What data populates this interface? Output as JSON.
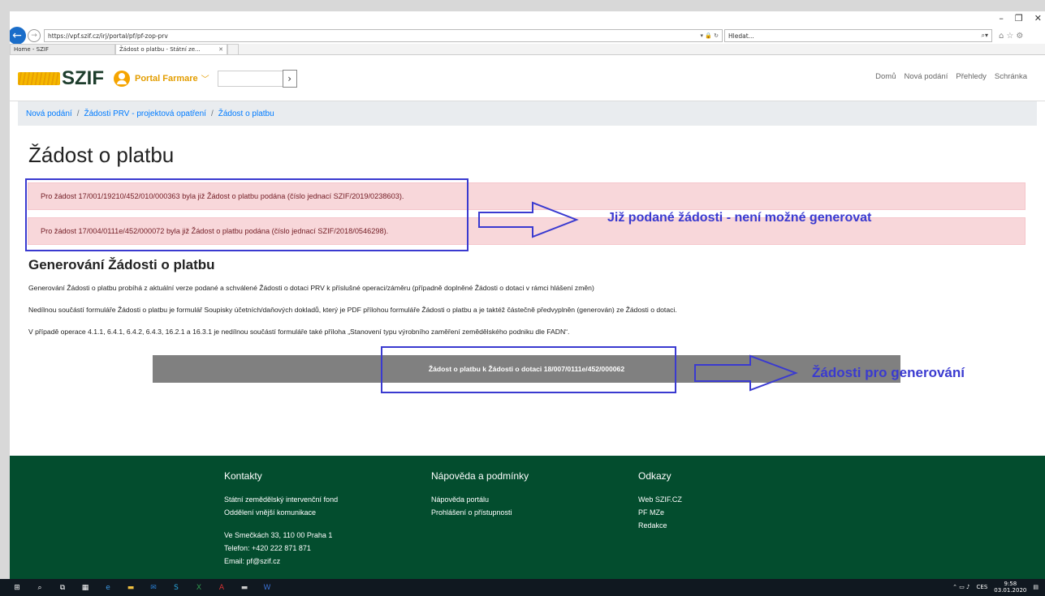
{
  "browser": {
    "url": "https://vpf.szif.cz/irj/portal/pf/pf-zop-prv",
    "search_placeholder": "Hledat...",
    "tabs": [
      {
        "label": "Home - SZIF"
      },
      {
        "label": "Žádost o platbu - Státní ze..."
      }
    ]
  },
  "header": {
    "logo": "SZIF",
    "portal": "Portal Farmare",
    "nav": [
      "Domů",
      "Nová podání",
      "Přehledy",
      "Schránka"
    ]
  },
  "breadcrumb": [
    "Nová podání",
    "Žádosti PRV - projektová opatření",
    "Žádost o platbu"
  ],
  "page_title": "Žádost o platbu",
  "alerts": [
    "Pro žádost 17/001/19210/452/010/000363 byla již Žádost o platbu podána (číslo jednací SZIF/2019/0238603).",
    "Pro žádost 17/004/0111e/452/000072 byla již Žádost o platbu podána (číslo jednací SZIF/2018/0546298)."
  ],
  "section": {
    "title": "Generování Žádosti o platbu",
    "paragraphs": [
      "Generování Žádosti o platbu probíhá z aktuální verze podané a schválené Žádosti o dotaci PRV k příslušné operaci/záměru (případně doplněné Žádosti o dotaci v rámci hlášení změn)",
      "Nedílnou součástí formuláře Žádosti o platbu je formulář Soupisky účetních/daňových dokladů, který je PDF přílohou formuláře Žádosti o platbu a je taktéž částečně předvyplněn (generován) ze Žádosti o dotaci.",
      "V případě operace 4.1.1, 6.4.1, 6.4.2, 6.4.3, 16.2.1 a 16.3.1 je nedílnou součástí formuláře také příloha „Stanovení typu výrobního zaměření zemědělského podniku dle FADN“."
    ],
    "button": "Žádost o platbu k Žádosti o dotaci 18/007/0111e/452/000062"
  },
  "annotations": {
    "submitted": "Již podané žádosti - není možné generovat",
    "to_generate": "Žádosti pro generování"
  },
  "footer": {
    "contacts_title": "Kontakty",
    "contacts": [
      "Státní zemědělský intervenční fond",
      "Oddělení vnější komunikace"
    ],
    "address": [
      "Ve Smečkách 33, 110 00 Praha 1",
      "Telefon: +420 222 871 871",
      "Email: pf@szif.cz"
    ],
    "help_title": "Nápověda a podmínky",
    "help": [
      "Nápověda portálu",
      "Prohlášení o přístupnosti"
    ],
    "links_title": "Odkazy",
    "links": [
      "Web SZIF.CZ",
      "PF MZe",
      "Redakce"
    ]
  },
  "taskbar": {
    "lang": "CES",
    "time": "9:58",
    "date": "03.01.2020"
  },
  "colors": {
    "annotation": "#3a3ad0",
    "footer": "#034d2e",
    "alert_bg": "#f8d7da",
    "button": "#808080"
  }
}
